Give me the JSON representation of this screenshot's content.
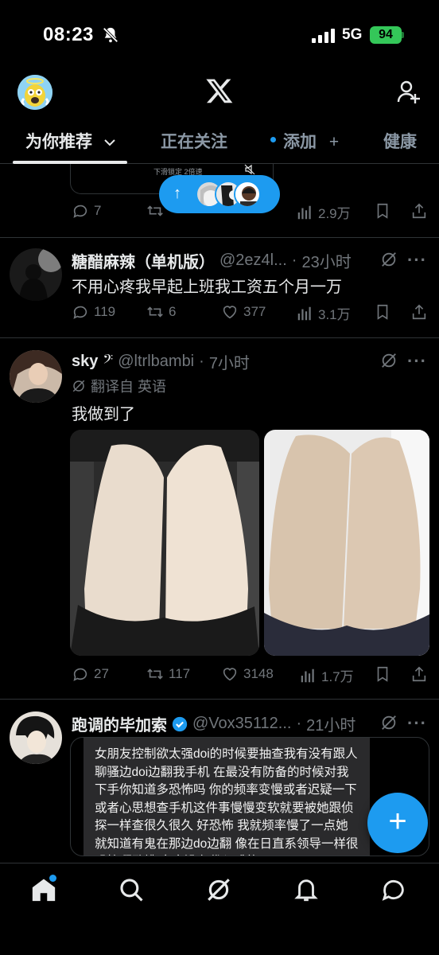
{
  "status_bar": {
    "time": "08:23",
    "network": "5G",
    "battery": "94"
  },
  "tabs": [
    {
      "label": "为你推荐",
      "chevron": "chevron-down-icon"
    },
    {
      "label": "正在关注"
    },
    {
      "label": "添加",
      "suffix": "+"
    },
    {
      "label": "健康"
    }
  ],
  "top_tweet": {
    "overlay_text": "下滑锁定 2倍速",
    "reply_count": "7",
    "views": "2.9万"
  },
  "tweets": [
    {
      "name": "糖醋麻辣（单机版）",
      "handle": "@2ez4l...",
      "time": "23小时",
      "text": "不用心疼我早起上班我工资五个月一万",
      "replies": "119",
      "retweets": "6",
      "likes": "377",
      "views": "3.1万"
    },
    {
      "name": "sky",
      "name_badge": "𝄢",
      "handle": "@ltrlbambi",
      "time": "7小时",
      "translated": "翻译自 英语",
      "text": "我做到了",
      "replies": "27",
      "retweets": "117",
      "likes": "3148",
      "views": "1.7万"
    },
    {
      "name": "跑调的毕加索",
      "handle": "@Vox35112...",
      "time": "21小时",
      "quote_text": "女朋友控制欲太强doi的时候要抽查我有没有跟人聊骚边doi边翻我手机 在最没有防备的时候对我下手你知道多恐怖吗 你的频率变慢或者迟疑一下或者心思想查手机这件事慢慢变软就要被她跟侦探一样查很久很久 好恐怖 我就频率慢了一点她就知道有鬼在那边do边翻 像在日直系领导一样很恐怖啊卧槽 完全没有代入感的"
    }
  ],
  "pill": {
    "arrow": "↑"
  },
  "fab": {
    "label": "+"
  },
  "colors": {
    "accent": "#1d9bf0",
    "text": "#e7e9ea",
    "muted": "#71767b",
    "battery": "#34c759"
  }
}
